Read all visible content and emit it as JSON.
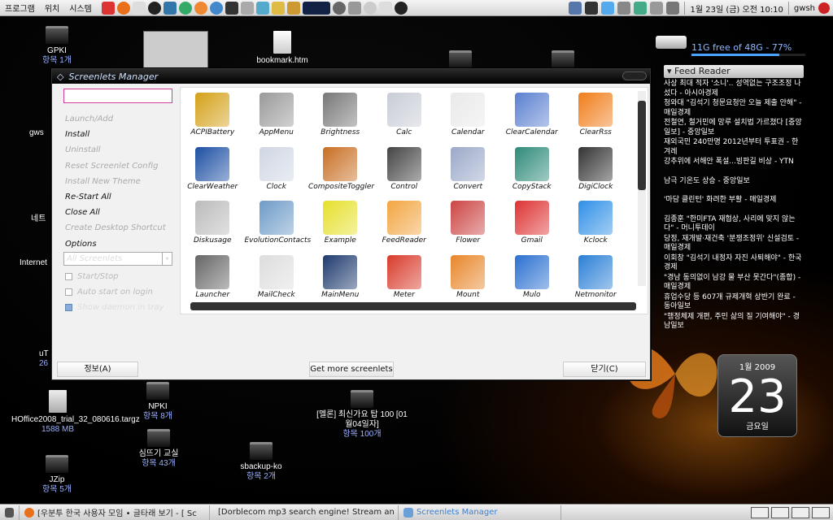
{
  "top_panel": {
    "menus": [
      "프로그램",
      "위치",
      "시스템"
    ],
    "user": "gwsh",
    "datetime": "1월 23일 (금) 오전 10:10"
  },
  "desktop_icons": [
    {
      "name": "GPKI",
      "sub": "항목 1개"
    },
    {
      "name": "bookmark.htm",
      "sub": ""
    },
    {
      "name": "gws",
      "sub": ""
    },
    {
      "name": "네트",
      "sub": ""
    },
    {
      "name": "Internet",
      "sub": ""
    },
    {
      "name": "uT",
      "sub": "26"
    },
    {
      "name": "HOffice2008_trial_32_080616.targz",
      "sub": "1588 MB"
    },
    {
      "name": "NPKI",
      "sub": "항목 8개"
    },
    {
      "name": "[멜론] 최신가요 탑 100 [01월04일자]",
      "sub": "항목 100개"
    },
    {
      "name": "심뜨기 교실",
      "sub": "항목 43개"
    },
    {
      "name": "sbackup-ko",
      "sub": "항목 2개"
    },
    {
      "name": "JZip",
      "sub": "항목 5개"
    }
  ],
  "drive_widget": {
    "label": "11G free of 48G - 77%",
    "used_fraction": 0.77
  },
  "feed": {
    "title": "Feed Reader",
    "items": [
      "사상 최대 적자 '소니'.. 성역없는 구조조정 나섰다 - 아시아경제",
      "청와대 \"김석기 청문요청안 오늘 제출 안해\" - 매일경제",
      "전철연, 철거민에 망루 설치법 가르쳤다 [중앙일보] - 중앙일보",
      "재외국민 240만명 2012년부터 투표권 - 한겨레",
      "강추위에 서해안 폭설...빙판길 비상 - YTN",
      "남극 기온도 상승 - 중앙일보",
      "'마담 클린턴' 화려한 부활 - 매일경제",
      "김종훈 \"한미FTA 재협상, 사리에 맞지 않는다\" - 머니투데이",
      "당정, 재개발·재건축 '분쟁조정위' 신설검토 - 매일경제",
      "이회창 \"김석기 내정자 자진 사퇴해야\" - 한국경제",
      "\"경남 동의없이 남강 물 부산 못간다\"(종합) - 매일경제",
      "휴업수당 등 607개 규제개혁 상반기 완료 - 동아일보",
      "\"행정체제 개편, 주민 삶의 질 기여해야\" - 경남일보"
    ]
  },
  "calendar": {
    "month": "1월 2009",
    "day": "23",
    "weekday": "금요일"
  },
  "window": {
    "title": "Screenlets Manager",
    "search_value": "",
    "actions": [
      {
        "label": "Launch/Add",
        "enabled": false
      },
      {
        "label": "Install",
        "enabled": true
      },
      {
        "label": "Uninstall",
        "enabled": false
      },
      {
        "label": "Reset Screenlet Config",
        "enabled": false
      },
      {
        "label": "Install New Theme",
        "enabled": false
      },
      {
        "label": "Re-Start All",
        "enabled": true
      },
      {
        "label": "Close All",
        "enabled": true
      },
      {
        "label": "Create Desktop Shortcut",
        "enabled": false
      },
      {
        "label": "Options",
        "enabled": true
      }
    ],
    "filter_selected": "All Screenlets",
    "checks": [
      {
        "label": "Start/Stop",
        "enabled": false,
        "checked": false
      },
      {
        "label": "Auto start on login",
        "enabled": false,
        "checked": false
      },
      {
        "label": "Show daemon in tray",
        "enabled": true,
        "checked": true
      }
    ],
    "screenlets": [
      {
        "name": "ACPIBattery",
        "color": "#d4a017"
      },
      {
        "name": "AppMenu",
        "color": "#999999"
      },
      {
        "name": "Brightness",
        "color": "#777777"
      },
      {
        "name": "Calc",
        "color": "#c8ccd6"
      },
      {
        "name": "Calendar",
        "color": "#e9e9e9"
      },
      {
        "name": "ClearCalendar",
        "color": "#5a7fd0"
      },
      {
        "name": "ClearRss",
        "color": "#f07d1a"
      },
      {
        "name": "ClearWeather",
        "color": "#1d4fa3"
      },
      {
        "name": "Clock",
        "color": "#cfd6e3"
      },
      {
        "name": "CompositeToggler",
        "color": "#c86e22"
      },
      {
        "name": "Control",
        "color": "#444444"
      },
      {
        "name": "Convert",
        "color": "#9aa8c8"
      },
      {
        "name": "CopyStack",
        "color": "#2d8a78"
      },
      {
        "name": "DigiClock",
        "color": "#333333"
      },
      {
        "name": "Diskusage",
        "color": "#bbbbbb"
      },
      {
        "name": "EvolutionContacts",
        "color": "#6d9bc8"
      },
      {
        "name": "Example",
        "color": "#e6e02a"
      },
      {
        "name": "FeedReader",
        "color": "#f2a541"
      },
      {
        "name": "Flower",
        "color": "#c44"
      },
      {
        "name": "Gmail",
        "color": "#d33"
      },
      {
        "name": "Kclock",
        "color": "#2f8fe6"
      },
      {
        "name": "Launcher",
        "color": "#666666"
      },
      {
        "name": "MailCheck",
        "color": "#dddddd"
      },
      {
        "name": "MainMenu",
        "color": "#1e3a6e"
      },
      {
        "name": "Meter",
        "color": "#d83a2a"
      },
      {
        "name": "Mount",
        "color": "#e8862a"
      },
      {
        "name": "Mulo",
        "color": "#2a6fd0"
      },
      {
        "name": "Netmonitor",
        "color": "#2a7fd6"
      }
    ],
    "btn_info": "정보(A)",
    "btn_more": "Get more screenlets",
    "btn_close": "닫기(C)"
  },
  "taskbar": {
    "tasks": [
      {
        "label": "[우분투 한국 사용자 모임 • 글타래 보기 - [ Sc",
        "active": false
      },
      {
        "label": "[Dorblecom mp3 search engine! Stream an",
        "active": false
      },
      {
        "label": "Screenlets Manager",
        "active": true
      }
    ]
  }
}
